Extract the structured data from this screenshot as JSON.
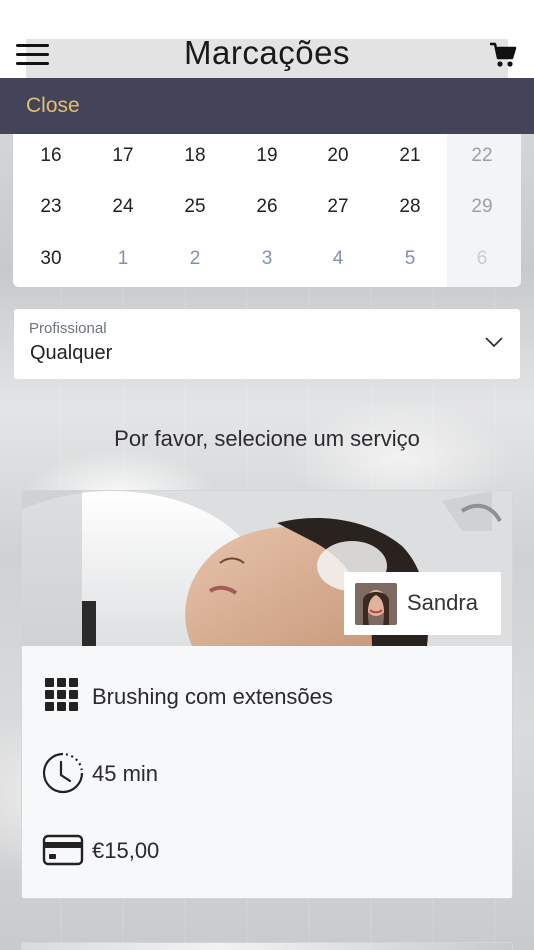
{
  "header": {
    "title": "Marcações",
    "menu_icon": "hamburger-menu-icon",
    "cart_icon": "shopping-cart-icon"
  },
  "close_bar": {
    "label": "Close",
    "bg_color": "#444458",
    "text_color": "#e7bd73"
  },
  "calendar": {
    "rows": [
      [
        {
          "d": "16",
          "s": "normal"
        },
        {
          "d": "17",
          "s": "normal"
        },
        {
          "d": "18",
          "s": "normal"
        },
        {
          "d": "19",
          "s": "normal"
        },
        {
          "d": "20",
          "s": "normal"
        },
        {
          "d": "21",
          "s": "normal"
        },
        {
          "d": "22",
          "s": "weekend"
        }
      ],
      [
        {
          "d": "23",
          "s": "normal"
        },
        {
          "d": "24",
          "s": "normal"
        },
        {
          "d": "25",
          "s": "normal"
        },
        {
          "d": "26",
          "s": "normal"
        },
        {
          "d": "27",
          "s": "normal"
        },
        {
          "d": "28",
          "s": "normal"
        },
        {
          "d": "29",
          "s": "weekend"
        }
      ],
      [
        {
          "d": "30",
          "s": "normal"
        },
        {
          "d": "1",
          "s": "muted"
        },
        {
          "d": "2",
          "s": "muted"
        },
        {
          "d": "3",
          "s": "muted"
        },
        {
          "d": "4",
          "s": "muted"
        },
        {
          "d": "5",
          "s": "muted"
        },
        {
          "d": "6",
          "s": "faded"
        }
      ]
    ]
  },
  "professional": {
    "label": "Profissional",
    "value": "Qualquer",
    "chevron_icon": "chevron-down-icon"
  },
  "service_prompt": "Por favor, selecione um serviço",
  "service": {
    "staff_name": "Sandra",
    "name": "Brushing com extensões",
    "duration": "45 min",
    "price": "€15,00",
    "icons": {
      "category": "grid-icon",
      "duration": "clock-icon",
      "price": "credit-card-icon"
    }
  }
}
